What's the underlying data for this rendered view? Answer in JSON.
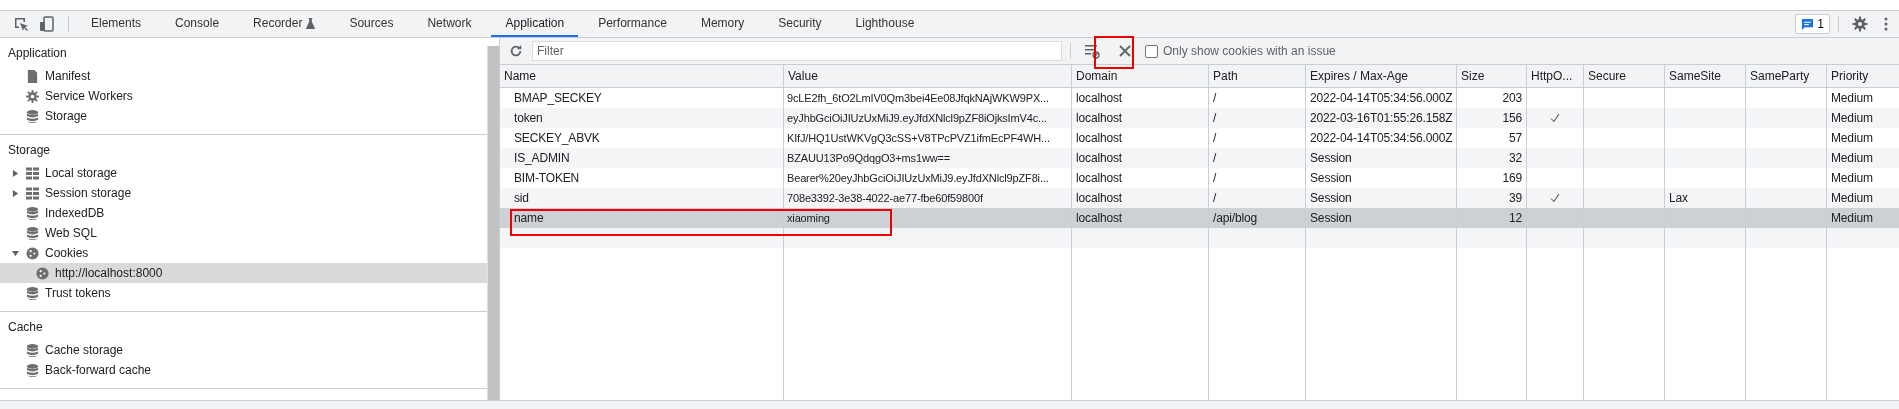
{
  "toolbar": {
    "tabs": [
      {
        "label": "Elements",
        "selected": false,
        "kind": "plain"
      },
      {
        "label": "Console",
        "selected": false,
        "kind": "plain"
      },
      {
        "label": "Recorder",
        "selected": false,
        "kind": "flask"
      },
      {
        "label": "Sources",
        "selected": false,
        "kind": "plain"
      },
      {
        "label": "Network",
        "selected": false,
        "kind": "plain"
      },
      {
        "label": "Application",
        "selected": true,
        "kind": "plain"
      },
      {
        "label": "Performance",
        "selected": false,
        "kind": "plain"
      },
      {
        "label": "Memory",
        "selected": false,
        "kind": "plain"
      },
      {
        "label": "Security",
        "selected": false,
        "kind": "plain"
      },
      {
        "label": "Lighthouse",
        "selected": false,
        "kind": "plain"
      }
    ],
    "issues_count": "1"
  },
  "sidebar": {
    "sections": [
      {
        "title": "Application",
        "items": [
          {
            "label": "Manifest",
            "selected": false
          },
          {
            "label": "Service Workers",
            "selected": false
          },
          {
            "label": "Storage",
            "selected": false
          }
        ]
      },
      {
        "title": "Storage",
        "items": [
          {
            "label": "Local storage",
            "expanded": false,
            "selected": false
          },
          {
            "label": "Session storage",
            "expanded": false,
            "selected": false
          },
          {
            "label": "IndexedDB",
            "selected": false
          },
          {
            "label": "Web SQL",
            "selected": false
          },
          {
            "label": "Cookies",
            "expanded": true,
            "selected": false,
            "children": [
              {
                "label": "http://localhost:8000",
                "selected": true
              }
            ]
          },
          {
            "label": "Trust tokens",
            "selected": false
          }
        ]
      },
      {
        "title": "Cache",
        "items": [
          {
            "label": "Cache storage",
            "selected": false
          },
          {
            "label": "Back-forward cache",
            "selected": false
          }
        ]
      }
    ]
  },
  "filter": {
    "placeholder": "Filter",
    "only_issues_label": "Only show cookies with an issue",
    "only_issues_checked": false
  },
  "table": {
    "columns": [
      "Name",
      "Value",
      "Domain",
      "Path",
      "Expires / Max-Age",
      "Size",
      "HttpO...",
      "Secure",
      "SameSite",
      "SameParty",
      "Priority"
    ],
    "rows": [
      {
        "name": "BMAP_SECKEY",
        "value": "9cLE2fh_6tO2LmIV0Qm3bei4Ee08JfqkNAjWKW9PX...",
        "domain": "localhost",
        "path": "/",
        "expires": "2022-04-14T05:34:56.000Z",
        "size": "203",
        "http_only": false,
        "priority": "Medium",
        "selected": false
      },
      {
        "name": "token",
        "value": "eyJhbGciOiJIUzUxMiJ9.eyJfdXNlcl9pZF8iOjksImV4c...",
        "domain": "localhost",
        "path": "/",
        "expires": "2022-03-16T01:55:26.158Z",
        "size": "156",
        "http_only": true,
        "priority": "Medium",
        "selected": false
      },
      {
        "name": "SECKEY_ABVK",
        "value": "KIfJ/HQ1UstWKVgQ3cSS+V8TPcPVZ1ifmEcPF4WH...",
        "domain": "localhost",
        "path": "/",
        "expires": "2022-04-14T05:34:56.000Z",
        "size": "57",
        "http_only": false,
        "priority": "Medium",
        "selected": false
      },
      {
        "name": "IS_ADMIN",
        "value": "BZAUU13Po9QdqgO3+ms1ww==",
        "domain": "localhost",
        "path": "/",
        "expires": "Session",
        "size": "32",
        "http_only": false,
        "priority": "Medium",
        "selected": false
      },
      {
        "name": "BIM-TOKEN",
        "value": "Bearer%20eyJhbGciOiJIUzUxMiJ9.eyJfdXNlcl9pZF8i...",
        "domain": "localhost",
        "path": "/",
        "expires": "Session",
        "size": "169",
        "http_only": false,
        "priority": "Medium",
        "selected": false
      },
      {
        "name": "sid",
        "value": "708e3392-3e38-4022-ae77-fbe60f59800f",
        "domain": "localhost",
        "path": "/",
        "expires": "Session",
        "size": "39",
        "http_only": true,
        "same_site": "Lax",
        "priority": "Medium",
        "selected": false
      },
      {
        "name": "name",
        "value": "xiaoming",
        "domain": "localhost",
        "path": "/api/blog",
        "expires": "Session",
        "size": "12",
        "http_only": false,
        "priority": "Medium",
        "selected": true
      }
    ]
  }
}
